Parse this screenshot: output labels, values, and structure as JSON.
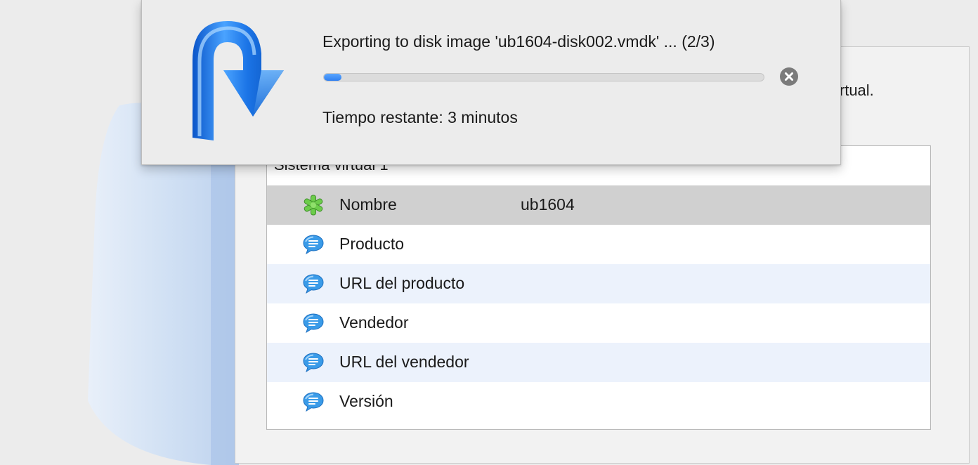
{
  "background": {
    "intro_text_fragment": "irtual."
  },
  "appliance": {
    "group_title": "Sistema virtual 1",
    "rows": [
      {
        "icon": "green-asterisk-icon",
        "label": "Nombre",
        "value": "ub1604",
        "state": "selected"
      },
      {
        "icon": "speech-bubble-icon",
        "label": "Producto",
        "value": "",
        "state": "normal"
      },
      {
        "icon": "speech-bubble-icon",
        "label": "URL del producto",
        "value": "",
        "state": "alt"
      },
      {
        "icon": "speech-bubble-icon",
        "label": "Vendedor",
        "value": "",
        "state": "normal"
      },
      {
        "icon": "speech-bubble-icon",
        "label": "URL del vendedor",
        "value": "",
        "state": "alt"
      },
      {
        "icon": "speech-bubble-icon",
        "label": "Versión",
        "value": "",
        "state": "normal"
      }
    ]
  },
  "progress": {
    "status": "Exporting to disk image 'ub1604-disk002.vmdk' ... (2/3)",
    "fraction": 0.04,
    "time_remaining": "Tiempo restante: 3 minutos",
    "icon": "export-arrow-icon",
    "cancel_icon": "close-circle-icon"
  },
  "colors": {
    "accent": "#2f7ff0",
    "selected_row": "#d0d0d0",
    "alt_row": "#ecf2fc"
  }
}
